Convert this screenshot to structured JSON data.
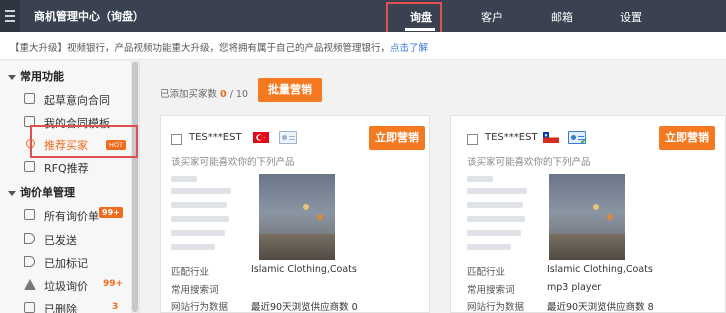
{
  "app": {
    "title": "商机管理中心（询盘）"
  },
  "nav": {
    "items": [
      "询盘",
      "客户",
      "邮箱",
      "设置"
    ],
    "active_index": 0
  },
  "notice": {
    "text": "【重大升级】视频银行，产品视频功能重大升级，您将拥有属于自己的产品视频管理银行，",
    "link": "点击了解"
  },
  "sidebar": {
    "group1": "常用功能",
    "items1": [
      {
        "label": "起草意向合同",
        "icon": "edit-icon"
      },
      {
        "label": "我的合同模板",
        "icon": "template-icon"
      },
      {
        "label": "推荐买家",
        "icon": "heart-icon",
        "badge": "HOT",
        "active": true
      },
      {
        "label": "RFQ推荐",
        "icon": "rfq-icon"
      }
    ],
    "group2": "询价单管理",
    "items2": [
      {
        "label": "所有询价单",
        "icon": "inbox-icon",
        "badge": "99+"
      },
      {
        "label": "已发送",
        "icon": "send-icon"
      },
      {
        "label": "已加标记",
        "icon": "flag-icon"
      },
      {
        "label": "垃圾询价",
        "icon": "warning-icon",
        "count": "99+"
      },
      {
        "label": "已删除",
        "icon": "trash-icon",
        "count": "3"
      }
    ]
  },
  "main": {
    "added_label": "已添加买家数",
    "added_count": "0",
    "added_total": "/ 10",
    "batch_button": "批量营销",
    "cards": [
      {
        "buyer": "TES***EST",
        "flag": "turkey",
        "promote": "立即营销",
        "maylike": "该买家可能喜欢你的下列产品",
        "industry_label": "匹配行业",
        "industry": "Islamic Clothing,Coats",
        "search_label": "常用搜索词",
        "search": "",
        "behavior_label": "网站行为数据",
        "behavior": "最近90天浏览供应商数 0"
      },
      {
        "buyer": "TES***EST",
        "flag": "chile",
        "promote": "立即营销",
        "maylike": "该买家可能喜欢你的下列产品",
        "industry_label": "匹配行业",
        "industry": "Islamic Clothing,Coats",
        "search_label": "常用搜索词",
        "search": "mp3 player",
        "behavior_label": "网站行为数据",
        "behavior": "最近90天浏览供应商数 8"
      }
    ]
  },
  "colors": {
    "topbar": "#3a4251",
    "accent": "#f47920",
    "highlight": "#e05050"
  }
}
